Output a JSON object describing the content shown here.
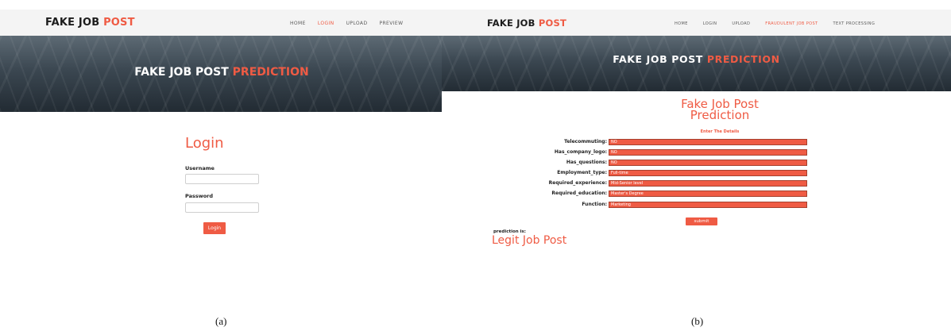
{
  "panel_a": {
    "logo": {
      "part1": "FAKE JOB",
      "part2": "POST"
    },
    "nav": [
      "HOME",
      "LOGIN",
      "UPLOAD",
      "PREVIEW"
    ],
    "hero": {
      "part1": "FAKE JOB POST",
      "part2": "PREDICTION"
    },
    "login": {
      "title": "Login",
      "username_label": "Username",
      "username_value": "",
      "password_label": "Password",
      "password_value": "",
      "button": "Login"
    }
  },
  "panel_b": {
    "logo": {
      "part1": "FAKE JOB",
      "part2": "POST"
    },
    "nav": [
      "HOME",
      "LOGIN",
      "UPLOAD",
      "FRAUDULENT JOB POST",
      "TEXT PROCESSING"
    ],
    "hero": {
      "part1": "FAKE JOB POST",
      "part2": "PREDICTION"
    },
    "title_line1": "Fake Job Post",
    "title_line2": "Prediction",
    "enter_details": "Enter The Details",
    "fields": [
      {
        "label": "Telecommuting:",
        "value": "NO"
      },
      {
        "label": "Has_company_logo:",
        "value": "NO"
      },
      {
        "label": "Has_questions:",
        "value": "NO"
      },
      {
        "label": "Employment_type:",
        "value": "Full-time"
      },
      {
        "label": "Required_experience:",
        "value": "Mid-Senior level"
      },
      {
        "label": "Required_education:",
        "value": "Master's Degree"
      },
      {
        "label": "Function:",
        "value": "Marketing"
      }
    ],
    "submit": "submit",
    "prediction_label": "prediction is:",
    "prediction_result": "Legit Job Post"
  },
  "captions": [
    "(a)",
    "(b)"
  ],
  "colors": {
    "accent": "#ef5b44",
    "navbar": "#f4f4f4",
    "dark_text": "#1c1c1c"
  }
}
